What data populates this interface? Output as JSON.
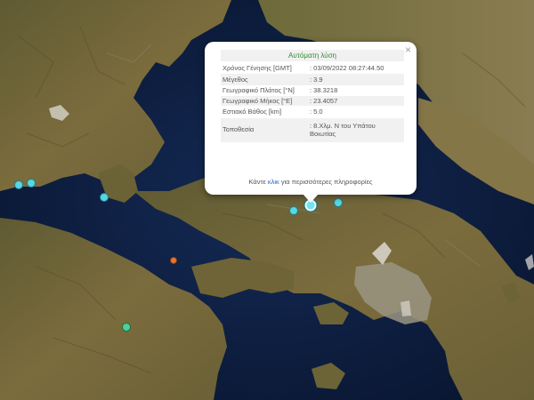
{
  "popup": {
    "title": "Αυτόματη λύση",
    "close_icon": "close-icon",
    "rows": [
      {
        "label": "Χρόνος Γένησης [GMT]",
        "value": ": 03/09/2022 08:27:44.50"
      },
      {
        "label": "Μέγεθος",
        "value": ": 3.9"
      },
      {
        "label": "Γεωγραφικό Πλάτος [°N]",
        "value": ": 38.3218"
      },
      {
        "label": "Γεωγραφικό Μήκος [°E]",
        "value": ": 23.4057"
      },
      {
        "label": "Εστιακό Βάθος [km]",
        "value": ": 5.0"
      },
      {
        "label": "Τοποθεσία",
        "value": ": 8.Χλμ. N του Υπάτου Βοιωτίας"
      }
    ],
    "footer_before": "Κάντε ",
    "footer_link": "κλικ",
    "footer_after": " για περισσότερες πληροφορίες"
  },
  "markers": [
    {
      "kind": "main",
      "color": "#6fe3ee"
    },
    {
      "kind": "cyan",
      "color": "#58d6e3"
    },
    {
      "kind": "green",
      "color": "#4fcf9a"
    },
    {
      "kind": "orange",
      "color": "#e8762c"
    }
  ],
  "colors": {
    "sea": "#0d1c3b",
    "land": "#7a6a3c",
    "title_green": "#2e8b2e",
    "link_blue": "#2a63c4"
  }
}
